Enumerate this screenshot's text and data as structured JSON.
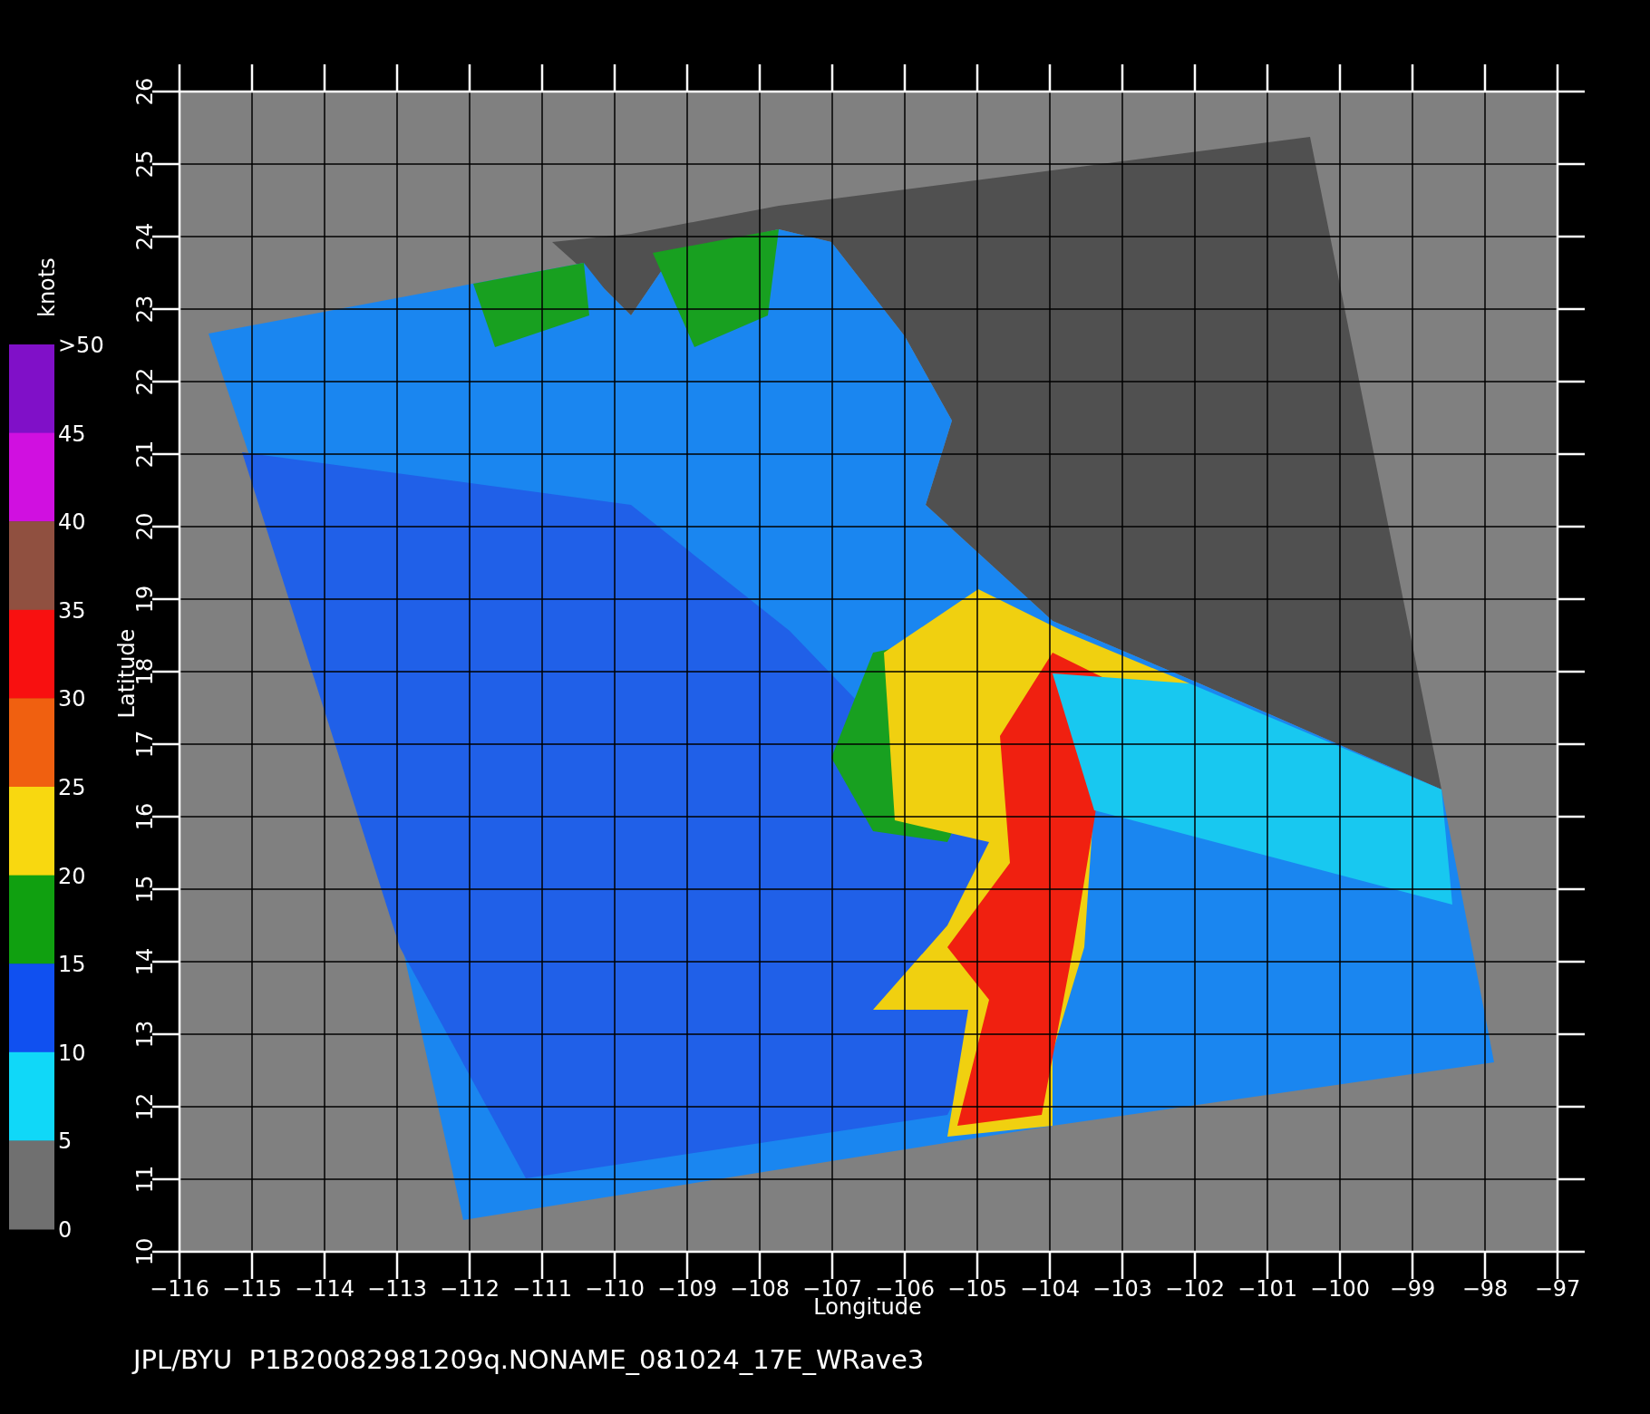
{
  "colorbar": {
    "title": "knots",
    "segments": [
      {
        "color": "#8010c8"
      },
      {
        "color": "#d010e0"
      },
      {
        "color": "#905040"
      },
      {
        "color": "#f81010"
      },
      {
        "color": "#f06010"
      },
      {
        "color": "#f8d810"
      },
      {
        "color": "#10a010"
      },
      {
        "color": "#1050f0"
      },
      {
        "color": "#10d8f8"
      },
      {
        "color": "#707070"
      }
    ],
    "labels": [
      ">50",
      "45",
      "40",
      "35",
      "30",
      "25",
      "20",
      "15",
      "10",
      "5",
      "0"
    ]
  },
  "x_axis": {
    "label": "Longitude",
    "ticks": [
      "−116",
      "−115",
      "−114",
      "−113",
      "−112",
      "−111",
      "−110",
      "−109",
      "−108",
      "−107",
      "−106",
      "−105",
      "−104",
      "−103",
      "−102",
      "−101",
      "−100",
      "−99",
      "−98",
      "−97"
    ]
  },
  "y_axis": {
    "label": "Latitude",
    "ticks": [
      "10",
      "11",
      "12",
      "13",
      "14",
      "15",
      "16",
      "17",
      "18",
      "19",
      "20",
      "21",
      "22",
      "23",
      "24",
      "25",
      "26"
    ]
  },
  "caption": "JPL/BYU  P1B20082981209q.NONAME_081024_17E_WRave3"
}
